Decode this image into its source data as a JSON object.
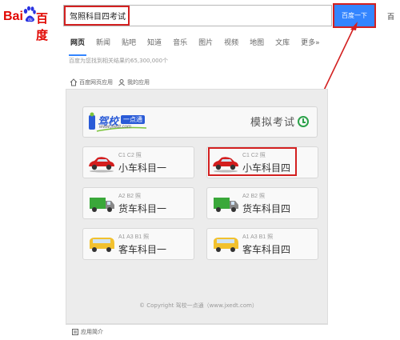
{
  "header": {
    "logo_text_left": "Bai",
    "logo_text_right": "百度",
    "search": {
      "value": "驾照科目四考试"
    },
    "search_button": "百度一下",
    "cut_text": "百"
  },
  "tabs": [
    {
      "label": "网页",
      "active": true
    },
    {
      "label": "新闻"
    },
    {
      "label": "贴吧"
    },
    {
      "label": "知道"
    },
    {
      "label": "音乐"
    },
    {
      "label": "图片"
    },
    {
      "label": "视频"
    },
    {
      "label": "地图"
    },
    {
      "label": "文库"
    },
    {
      "label": "更多»"
    }
  ],
  "result_count": "百度为您找到相关结果约65,300,000个",
  "breadcrumb": {
    "home": "百度网页应用",
    "mine": "我的应用"
  },
  "app": {
    "brand_main": "驾校",
    "brand_tag": "一点通",
    "brand_url": "www.jxedt.com",
    "title": "模拟考试",
    "cards": [
      {
        "sub": "C1 C2 照",
        "title": "小车科目一",
        "icon": "red-car-icon"
      },
      {
        "sub": "C1 C2 照",
        "title": "小车科目四",
        "icon": "red-car-icon"
      },
      {
        "sub": "A2 B2 照",
        "title": "货车科目一",
        "icon": "green-truck-icon"
      },
      {
        "sub": "A2 B2 照",
        "title": "货车科目四",
        "icon": "green-truck-icon"
      },
      {
        "sub": "A1 A3 B1 照",
        "title": "客车科目一",
        "icon": "yellow-bus-icon"
      },
      {
        "sub": "A1 A3 B1 照",
        "title": "客车科目四",
        "icon": "yellow-bus-icon"
      }
    ],
    "copyright": "© Copyright 驾校一点通（www.jxedt.com）"
  },
  "footer": {
    "label": "应用简介"
  },
  "colors": {
    "accent": "#3385ff",
    "highlight": "#d32020",
    "brand_blue": "#2a5bd7"
  }
}
